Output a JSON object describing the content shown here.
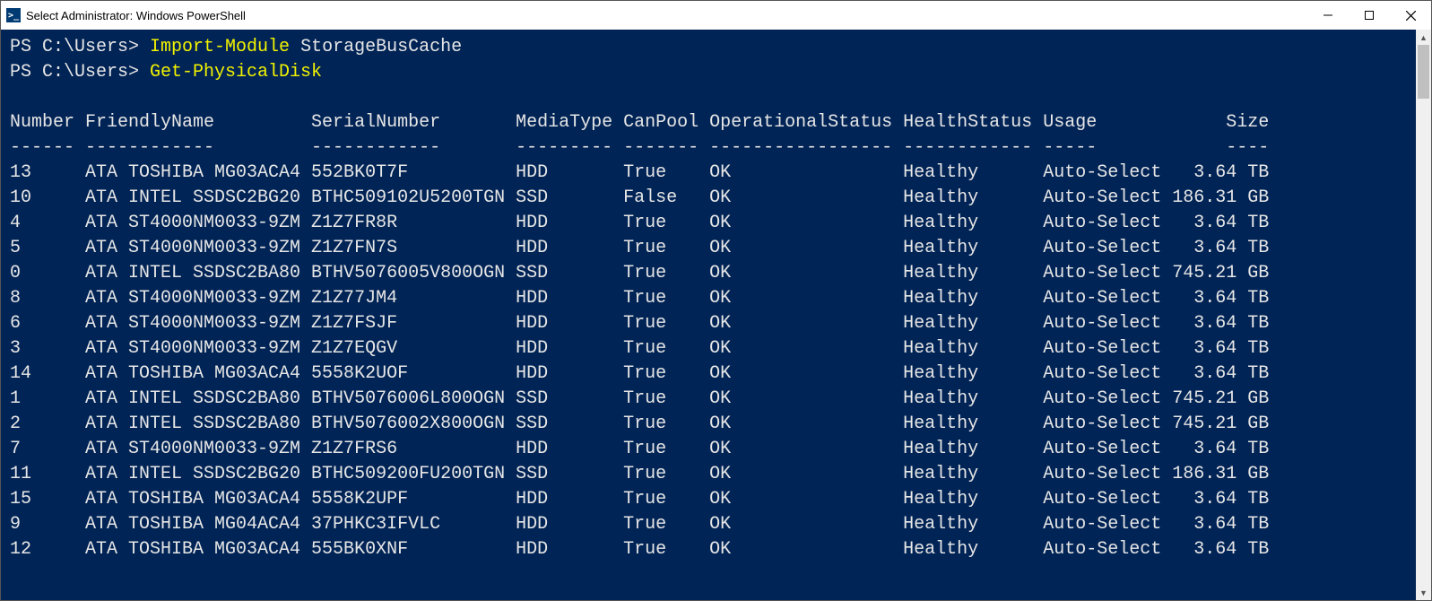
{
  "window": {
    "title": "Select Administrator: Windows PowerShell"
  },
  "terminal": {
    "prompt1": "PS C:\\Users>",
    "cmd1": "Import-Module",
    "arg1": "StorageBusCache",
    "prompt2": "PS C:\\Users>",
    "cmd2": "Get-PhysicalDisk"
  },
  "table": {
    "headers": {
      "number": "Number",
      "friendlyName": "FriendlyName",
      "serialNumber": "SerialNumber",
      "mediaType": "MediaType",
      "canPool": "CanPool",
      "opStatus": "OperationalStatus",
      "healthStatus": "HealthStatus",
      "usage": "Usage",
      "size": "Size"
    },
    "separators": {
      "number": "------",
      "friendlyName": "------------",
      "serialNumber": "------------",
      "mediaType": "---------",
      "canPool": "-------",
      "opStatus": "-----------------",
      "healthStatus": "------------",
      "usage": "-----",
      "size": "----"
    },
    "rows": [
      {
        "num": "13",
        "fn": "ATA TOSHIBA MG03ACA4",
        "sn": "552BK0T7F",
        "mt": "HDD",
        "cp": "True",
        "os": "OK",
        "hs": "Healthy",
        "us": "Auto-Select",
        "sz": "3.64 TB"
      },
      {
        "num": "10",
        "fn": "ATA INTEL SSDSC2BG20",
        "sn": "BTHC509102U5200TGN",
        "mt": "SSD",
        "cp": "False",
        "os": "OK",
        "hs": "Healthy",
        "us": "Auto-Select",
        "sz": "186.31 GB"
      },
      {
        "num": "4",
        "fn": "ATA ST4000NM0033-9ZM",
        "sn": "Z1Z7FR8R",
        "mt": "HDD",
        "cp": "True",
        "os": "OK",
        "hs": "Healthy",
        "us": "Auto-Select",
        "sz": "3.64 TB"
      },
      {
        "num": "5",
        "fn": "ATA ST4000NM0033-9ZM",
        "sn": "Z1Z7FN7S",
        "mt": "HDD",
        "cp": "True",
        "os": "OK",
        "hs": "Healthy",
        "us": "Auto-Select",
        "sz": "3.64 TB"
      },
      {
        "num": "0",
        "fn": "ATA INTEL SSDSC2BA80",
        "sn": "BTHV5076005V800OGN",
        "mt": "SSD",
        "cp": "True",
        "os": "OK",
        "hs": "Healthy",
        "us": "Auto-Select",
        "sz": "745.21 GB"
      },
      {
        "num": "8",
        "fn": "ATA ST4000NM0033-9ZM",
        "sn": "Z1Z77JM4",
        "mt": "HDD",
        "cp": "True",
        "os": "OK",
        "hs": "Healthy",
        "us": "Auto-Select",
        "sz": "3.64 TB"
      },
      {
        "num": "6",
        "fn": "ATA ST4000NM0033-9ZM",
        "sn": "Z1Z7FSJF",
        "mt": "HDD",
        "cp": "True",
        "os": "OK",
        "hs": "Healthy",
        "us": "Auto-Select",
        "sz": "3.64 TB"
      },
      {
        "num": "3",
        "fn": "ATA ST4000NM0033-9ZM",
        "sn": "Z1Z7EQGV",
        "mt": "HDD",
        "cp": "True",
        "os": "OK",
        "hs": "Healthy",
        "us": "Auto-Select",
        "sz": "3.64 TB"
      },
      {
        "num": "14",
        "fn": "ATA TOSHIBA MG03ACA4",
        "sn": "5558K2UOF",
        "mt": "HDD",
        "cp": "True",
        "os": "OK",
        "hs": "Healthy",
        "us": "Auto-Select",
        "sz": "3.64 TB"
      },
      {
        "num": "1",
        "fn": "ATA INTEL SSDSC2BA80",
        "sn": "BTHV5076006L800OGN",
        "mt": "SSD",
        "cp": "True",
        "os": "OK",
        "hs": "Healthy",
        "us": "Auto-Select",
        "sz": "745.21 GB"
      },
      {
        "num": "2",
        "fn": "ATA INTEL SSDSC2BA80",
        "sn": "BTHV5076002X800OGN",
        "mt": "SSD",
        "cp": "True",
        "os": "OK",
        "hs": "Healthy",
        "us": "Auto-Select",
        "sz": "745.21 GB"
      },
      {
        "num": "7",
        "fn": "ATA ST4000NM0033-9ZM",
        "sn": "Z1Z7FRS6",
        "mt": "HDD",
        "cp": "True",
        "os": "OK",
        "hs": "Healthy",
        "us": "Auto-Select",
        "sz": "3.64 TB"
      },
      {
        "num": "11",
        "fn": "ATA INTEL SSDSC2BG20",
        "sn": "BTHC509200FU200TGN",
        "mt": "SSD",
        "cp": "True",
        "os": "OK",
        "hs": "Healthy",
        "us": "Auto-Select",
        "sz": "186.31 GB"
      },
      {
        "num": "15",
        "fn": "ATA TOSHIBA MG03ACA4",
        "sn": "5558K2UPF",
        "mt": "HDD",
        "cp": "True",
        "os": "OK",
        "hs": "Healthy",
        "us": "Auto-Select",
        "sz": "3.64 TB"
      },
      {
        "num": "9",
        "fn": "ATA TOSHIBA MG04ACA4",
        "sn": "37PHKC3IFVLC",
        "mt": "HDD",
        "cp": "True",
        "os": "OK",
        "hs": "Healthy",
        "us": "Auto-Select",
        "sz": "3.64 TB"
      },
      {
        "num": "12",
        "fn": "ATA TOSHIBA MG03ACA4",
        "sn": "555BK0XNF",
        "mt": "HDD",
        "cp": "True",
        "os": "OK",
        "hs": "Healthy",
        "us": "Auto-Select",
        "sz": "3.64 TB"
      }
    ]
  },
  "columns": {
    "num": 7,
    "fn": 21,
    "sn": 19,
    "mt": 10,
    "cp": 8,
    "os": 18,
    "hs": 13,
    "us": 12,
    "sz": 9
  }
}
